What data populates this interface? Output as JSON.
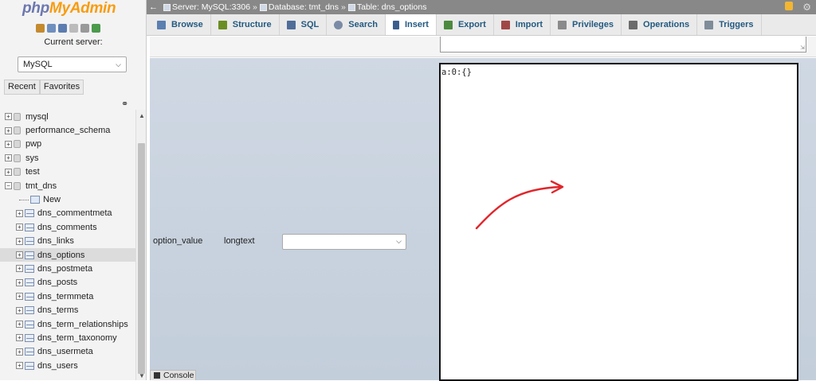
{
  "sidebar": {
    "logo_php": "php",
    "logo_admin": "MyAdmin",
    "current_server_label": "Current server:",
    "server_select_value": "MySQL",
    "recent_label": "Recent",
    "favorites_label": "Favorites",
    "databases": [
      {
        "name": "mysql"
      },
      {
        "name": "performance_schema"
      },
      {
        "name": "pwp"
      },
      {
        "name": "sys"
      },
      {
        "name": "test"
      },
      {
        "name": "tmt_dns",
        "expanded": true
      }
    ],
    "tmt_dns_items": {
      "new_label": "New",
      "tables": [
        "dns_commentmeta",
        "dns_comments",
        "dns_links",
        "dns_options",
        "dns_postmeta",
        "dns_posts",
        "dns_termmeta",
        "dns_terms",
        "dns_term_relationships",
        "dns_term_taxonomy",
        "dns_usermeta",
        "dns_users"
      ],
      "active_table": "dns_options"
    }
  },
  "breadcrumb": {
    "server": "Server: MySQL:3306",
    "database": "Database: tmt_dns",
    "table": "Table: dns_options",
    "separator": "»"
  },
  "tabs": [
    {
      "label": "Browse",
      "icon": "browse-icon",
      "color": "#5a7fb0"
    },
    {
      "label": "Structure",
      "icon": "structure-icon",
      "color": "#6b8e23"
    },
    {
      "label": "SQL",
      "icon": "sql-icon",
      "color": "#4f6d99"
    },
    {
      "label": "Search",
      "icon": "search-icon",
      "color": "#7b8aa6"
    },
    {
      "label": "Insert",
      "icon": "insert-icon",
      "color": "#3a5d8f",
      "active": true
    },
    {
      "label": "Export",
      "icon": "export-icon",
      "color": "#4d8a3f"
    },
    {
      "label": "Import",
      "icon": "import-icon",
      "color": "#a04848"
    },
    {
      "label": "Privileges",
      "icon": "privileges-icon",
      "color": "#8a8a8a"
    },
    {
      "label": "Operations",
      "icon": "operations-icon",
      "color": "#6b6b6b"
    },
    {
      "label": "Triggers",
      "icon": "triggers-icon",
      "color": "#7f8c99"
    }
  ],
  "insert_form": {
    "column_name": "option_value",
    "column_type": "longtext",
    "function_value": "",
    "value_text": "a:0:{}"
  },
  "console_label": "Console",
  "colors": {
    "annotation_arrow": "#e0262b",
    "field_bg": "#c9d3df",
    "tab_text": "#235a81"
  }
}
